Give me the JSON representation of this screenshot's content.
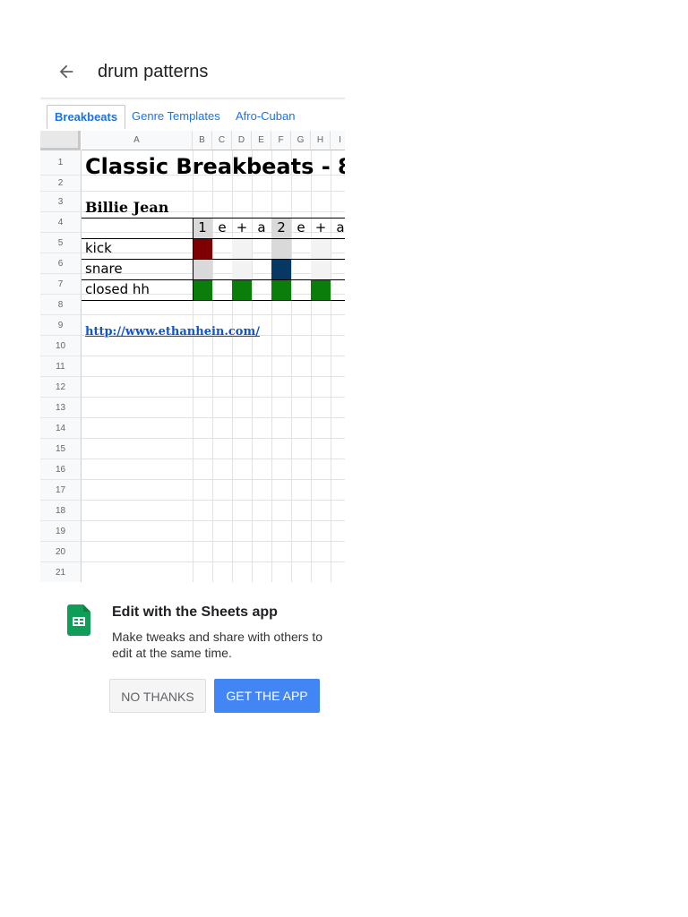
{
  "header": {
    "title": "drum patterns",
    "back_icon": "arrow-left-icon"
  },
  "tabs": [
    {
      "label": "Breakbeats",
      "active": true
    },
    {
      "label": "Genre Templates",
      "active": false
    },
    {
      "label": "Afro-Cuban",
      "active": false
    }
  ],
  "columns": [
    "A",
    "B",
    "C",
    "D",
    "E",
    "F",
    "G",
    "H",
    "I"
  ],
  "rows": [
    "1",
    "2",
    "3",
    "4",
    "5",
    "6",
    "7",
    "8",
    "9",
    "10",
    "11",
    "12",
    "13",
    "14",
    "15",
    "16",
    "17",
    "18",
    "19",
    "20",
    "21"
  ],
  "sheet": {
    "title": "Classic Breakbeats - 8",
    "song": "Billie Jean",
    "beats": [
      "1",
      "e",
      "+",
      "a",
      "2",
      "e",
      "+",
      "a"
    ],
    "instruments": [
      "kick",
      "snare",
      "closed hh"
    ],
    "link": "http://www.ethanhein.com/",
    "colors": {
      "kick": "#7f0000",
      "snare": "#073763",
      "hihat": "#0b7d0b",
      "shade": "#d9d9d9",
      "light": "#f3f3f3"
    }
  },
  "promo": {
    "title": "Edit with the Sheets app",
    "text": "Make tweaks and share with others to edit at the same time.",
    "no_label": "NO THANKS",
    "get_label": "GET THE APP",
    "icon": "google-sheets-icon"
  }
}
